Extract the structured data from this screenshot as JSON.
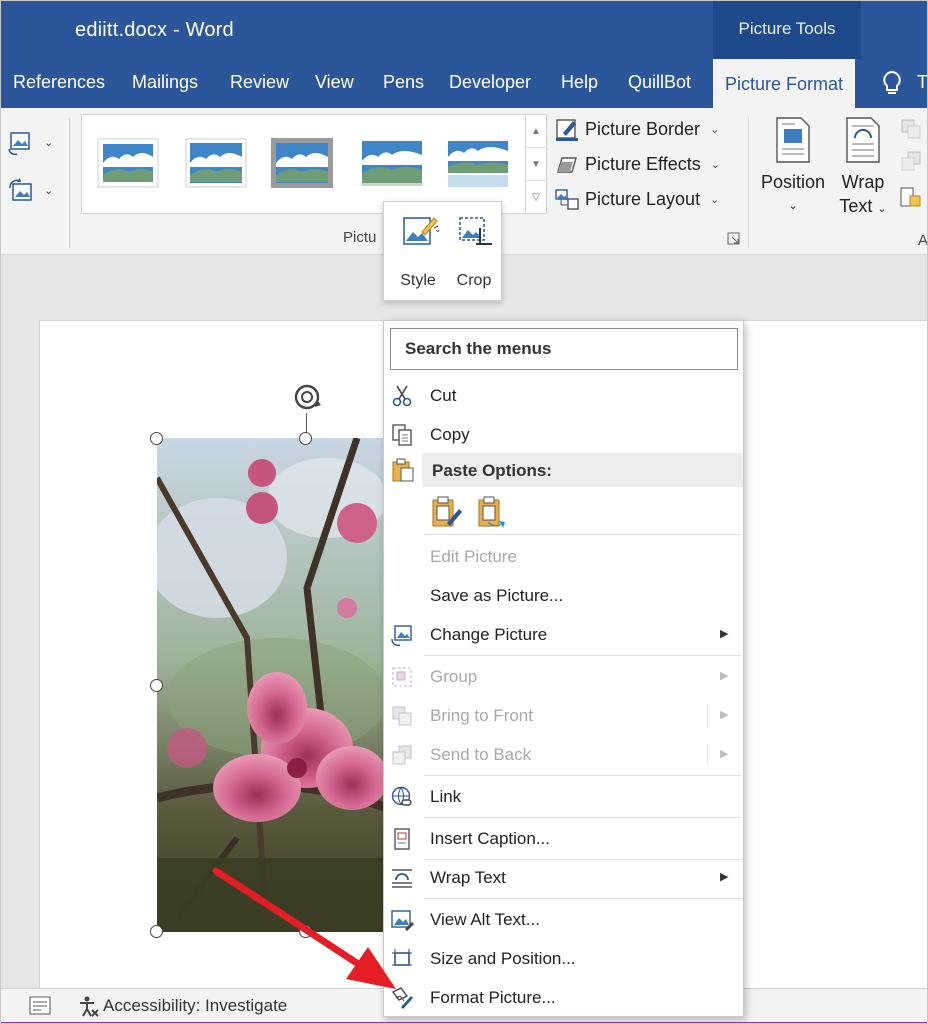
{
  "window": {
    "title": "ediitt.docx  -  Word",
    "contextual_band": "Picture Tools"
  },
  "tabs": [
    {
      "label": "References"
    },
    {
      "label": "Mailings"
    },
    {
      "label": "Review"
    },
    {
      "label": "View"
    },
    {
      "label": "Pens"
    },
    {
      "label": "Developer"
    },
    {
      "label": "Help"
    },
    {
      "label": "QuillBot"
    },
    {
      "label": "Picture Format",
      "active": true
    }
  ],
  "tab_overflow": "T",
  "ribbon": {
    "picture_border": "Picture Border",
    "picture_effects": "Picture Effects",
    "picture_layout": "Picture Layout",
    "group_label": "Pictu",
    "position": "Position",
    "wrap_line1": "Wrap",
    "wrap_line2": "Text",
    "partial_label": "A"
  },
  "minitoolbar": {
    "style": "Style",
    "crop": "Crop"
  },
  "context_menu": {
    "search_placeholder": "Search the menus",
    "cut": "Cut",
    "copy": "Copy",
    "paste_options": "Paste Options:",
    "edit_picture": "Edit Picture",
    "save_as_picture": "Save as Picture...",
    "change_picture": "Change Picture",
    "group": "Group",
    "bring_to_front": "Bring to Front",
    "send_to_back": "Send to Back",
    "link": "Link",
    "insert_caption": "Insert Caption...",
    "wrap_text": "Wrap Text",
    "view_alt_text": "View Alt Text...",
    "size_and_position": "Size and Position...",
    "format_picture": "Format Picture..."
  },
  "statusbar": {
    "accessibility": "Accessibility: Investigate"
  },
  "colors": {
    "word_blue": "#2b579a",
    "annotation_red": "#e31e24",
    "status_purple": "#8a3c8a"
  }
}
